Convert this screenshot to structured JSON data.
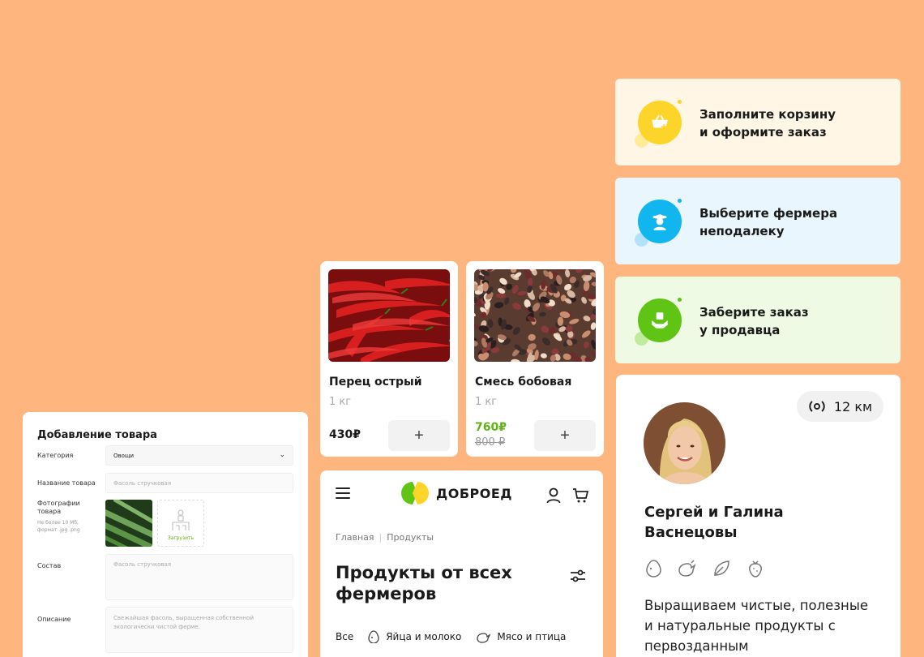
{
  "steps": [
    {
      "text": "Заполните корзину\nи оформите заказ",
      "icon": "basket-icon",
      "bg": "#FFF6E6",
      "accent": "#FDD52A",
      "light": "#FFE98A"
    },
    {
      "text": "Выберите фермера\nнеподалеку",
      "icon": "farmer-icon",
      "bg": "#E9F6FD",
      "accent": "#11B6EF",
      "light": "#A8DEF8"
    },
    {
      "text": "Заберите заказ\nу продавца",
      "icon": "hands-box-icon",
      "bg": "#EFFAE4",
      "accent": "#5FC414",
      "light": "#B6E88E"
    }
  ],
  "products": [
    {
      "name": "Перец острый",
      "weight": "1 кг",
      "price": "430₽",
      "add_label": "+"
    },
    {
      "name": "Смесь бобовая",
      "weight": "1 кг",
      "price": "760₽",
      "old_price": "800 ₽",
      "add_label": "+"
    }
  ],
  "form": {
    "title": "Добавление товара",
    "category_label": "Категория",
    "category_value": "Овощи",
    "name_label": "Название товара",
    "name_placeholder": "Фасоль стручковая",
    "photos_label": "Фотографии товара",
    "photos_hint": "Не более 10 Мб, формат .jpg .png",
    "upload_label": "Загрузить",
    "composition_label": "Состав",
    "composition_placeholder": "Фасоль стручковая",
    "description_label": "Описание",
    "description_placeholder": "Свежайшая фасоль, выращенная собственной экологически чистой ферме."
  },
  "mobile": {
    "brand": "ДОБРОЕД",
    "crumb_home": "Главная",
    "crumb_products": "Продукты",
    "title": "Продукты от всех фермеров",
    "tabs": [
      "Все",
      "Яйца и молоко",
      "Мясо и птица"
    ]
  },
  "farmer": {
    "distance": "12 км",
    "name": "Сергей и Галина\nВаснецовы",
    "category_icons": [
      "egg-icon",
      "poultry-icon",
      "greens-icon",
      "berry-icon"
    ],
    "description": "Выращиваем чистые, полезные и натуральные продукты с первозданным"
  }
}
